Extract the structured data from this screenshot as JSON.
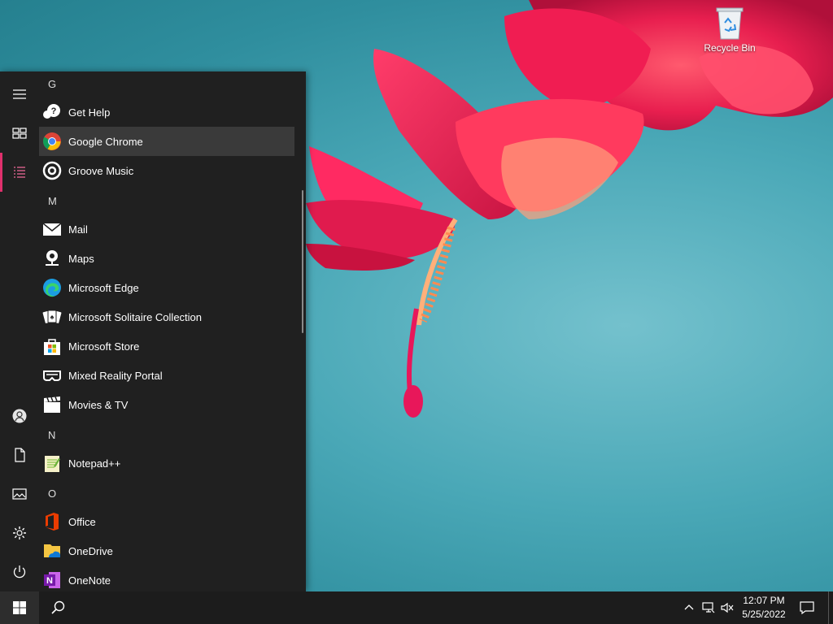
{
  "desktop": {
    "recycle_bin_label": "Recycle Bin"
  },
  "start_menu": {
    "rail": [
      {
        "id": "expand",
        "icon": "hamburger-icon"
      },
      {
        "id": "tiles",
        "icon": "tiles-icon"
      },
      {
        "id": "all-apps",
        "icon": "all-apps-list-icon",
        "active": true
      },
      {
        "id": "user",
        "icon": "user-account-icon"
      },
      {
        "id": "documents",
        "icon": "documents-icon"
      },
      {
        "id": "pictures",
        "icon": "pictures-icon"
      },
      {
        "id": "settings",
        "icon": "settings-gear-icon"
      },
      {
        "id": "power",
        "icon": "power-icon"
      }
    ],
    "sections": {
      "g": "G",
      "m": "M",
      "n": "N",
      "o": "O"
    },
    "apps": {
      "get_help": "Get Help",
      "google_chrome": "Google Chrome",
      "groove_music": "Groove Music",
      "mail": "Mail",
      "maps": "Maps",
      "microsoft_edge": "Microsoft Edge",
      "solitaire": "Microsoft Solitaire Collection",
      "microsoft_store": "Microsoft Store",
      "mixed_reality_portal": "Mixed Reality Portal",
      "movies_tv": "Movies & TV",
      "notepadpp": "Notepad++",
      "office": "Office",
      "onedrive": "OneDrive",
      "onenote": "OneNote"
    },
    "hovered_app": "Google Chrome"
  },
  "taskbar": {
    "time": "12:07 PM",
    "date": "5/25/2022"
  },
  "colors": {
    "accent": "#e0306c",
    "start_bg": "#202020",
    "taskbar_bg": "#1c1c1c",
    "hover_bg": "#3a3a3a"
  }
}
